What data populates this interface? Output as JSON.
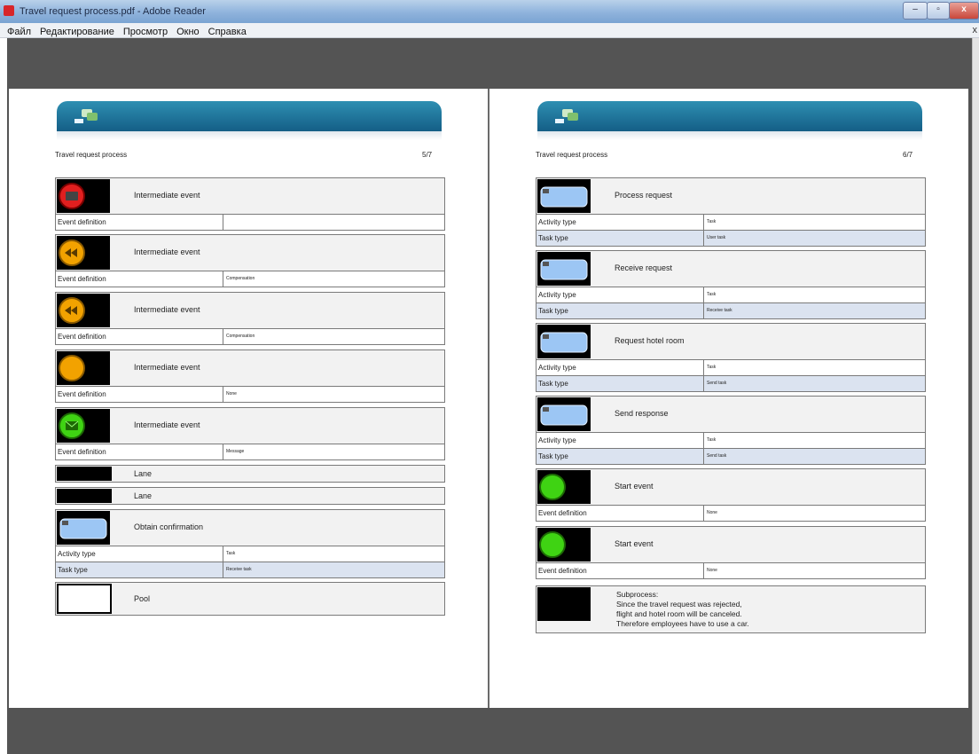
{
  "window": {
    "title": "Travel request process.pdf - Adobe Reader",
    "min_glyph": "–",
    "max_glyph": "▫",
    "close_glyph": "x"
  },
  "menu": {
    "items": [
      "Файл",
      "Редактирование",
      "Просмотр",
      "Окно",
      "Справка"
    ],
    "close_glyph": "x"
  },
  "pages": {
    "left": {
      "title": "Travel request process",
      "page": "5/7",
      "blocks": [
        {
          "label": "Intermediate event",
          "prop_key": "Event definition",
          "prop_val": ""
        },
        {
          "label": "Intermediate event",
          "prop_key": "Event definition",
          "prop_val": "Compensation"
        },
        {
          "label": "Intermediate event",
          "prop_key": "Event definition",
          "prop_val": "Compensation"
        },
        {
          "label": "Intermediate event",
          "prop_key": "Event definition",
          "prop_val": "None"
        },
        {
          "label": "Intermediate event",
          "prop_key": "Event definition",
          "prop_val": "Message"
        }
      ],
      "lanes": [
        "Lane",
        "Lane"
      ],
      "task": {
        "label": "Obtain confirmation",
        "activity_key": "Activity type",
        "activity_val": "Task",
        "task_key": "Task type",
        "task_val": "Receive task"
      },
      "pool": "Pool"
    },
    "right": {
      "title": "Travel request process",
      "page": "6/7",
      "tasks": [
        {
          "label": "Process request",
          "activity_key": "Activity type",
          "activity_val": "Task",
          "task_key": "Task type",
          "task_val": "User task"
        },
        {
          "label": "Receive request",
          "activity_key": "Activity type",
          "activity_val": "Task",
          "task_key": "Task type",
          "task_val": "Receive task"
        },
        {
          "label": "Request hotel room",
          "activity_key": "Activity type",
          "activity_val": "Task",
          "task_key": "Task type",
          "task_val": "Send task"
        },
        {
          "label": "Send response",
          "activity_key": "Activity type",
          "activity_val": "Task",
          "task_key": "Task type",
          "task_val": "Send task"
        }
      ],
      "starts": [
        {
          "label": "Start event",
          "prop_key": "Event definition",
          "prop_val": "None"
        },
        {
          "label": "Start event",
          "prop_key": "Event definition",
          "prop_val": "None"
        }
      ],
      "subprocess": [
        "Subprocess:",
        "Since the travel request was rejected,",
        "flight and hotel room will be canceled.",
        "Therefore employees have to use a car."
      ]
    }
  },
  "colors": {
    "header_blue": "#1a6f98",
    "event_red": "#e11f1f",
    "event_orange": "#f2a200",
    "event_green": "#3fd313",
    "task_blue": "#9cc6f4"
  },
  "icons": [
    "adobe-reader-icon",
    "logo-icon",
    "message-event-icon",
    "compensation-event-icon",
    "none-event-icon",
    "task-icon",
    "start-event-icon"
  ]
}
